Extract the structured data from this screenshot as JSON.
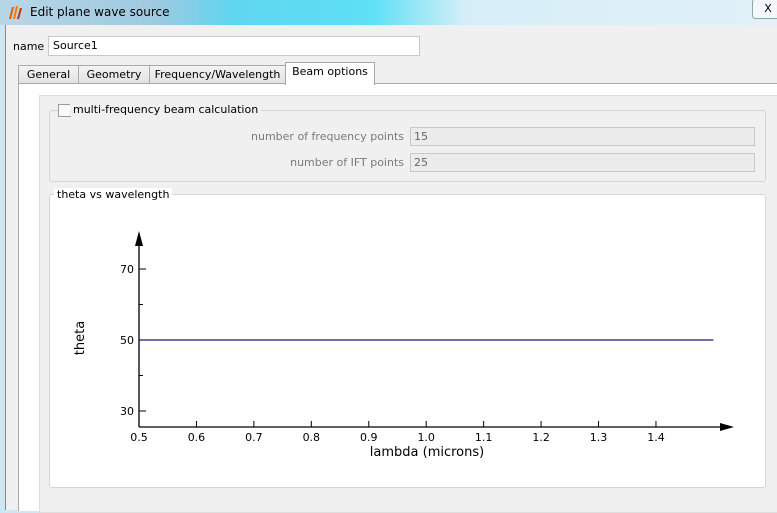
{
  "window": {
    "title": "Edit plane wave source",
    "close_label": "X"
  },
  "name_field": {
    "label": "name",
    "value": "Source1"
  },
  "tabs": [
    {
      "label": "General"
    },
    {
      "label": "Geometry"
    },
    {
      "label": "Frequency/Wavelength"
    },
    {
      "label": "Beam options",
      "active": true
    }
  ],
  "beam": {
    "multi_frequency_label": "multi-frequency beam calculation",
    "multi_frequency_checked": false,
    "freq_points_label": "number of frequency points",
    "freq_points_value": "15",
    "ift_points_label": "number of IFT points",
    "ift_points_value": "25",
    "chart_group_title": "theta vs wavelength"
  },
  "chart_data": {
    "type": "line",
    "title": "theta vs wavelength",
    "xlabel": "lambda (microns)",
    "ylabel": "theta",
    "xlim": [
      0.5,
      1.52
    ],
    "ylim": [
      25.5,
      80
    ],
    "xticks": [
      "0.5",
      "0.6",
      "0.7",
      "0.8",
      "0.9",
      "1.0",
      "1.1",
      "1.2",
      "1.3",
      "1.4"
    ],
    "yticks": [
      "30",
      "50",
      "70"
    ],
    "yminor": [
      40,
      60
    ],
    "series": [
      {
        "name": "theta",
        "x": [
          0.5,
          1.5
        ],
        "y": [
          50,
          50
        ],
        "color": "#1a1a6e"
      }
    ]
  }
}
